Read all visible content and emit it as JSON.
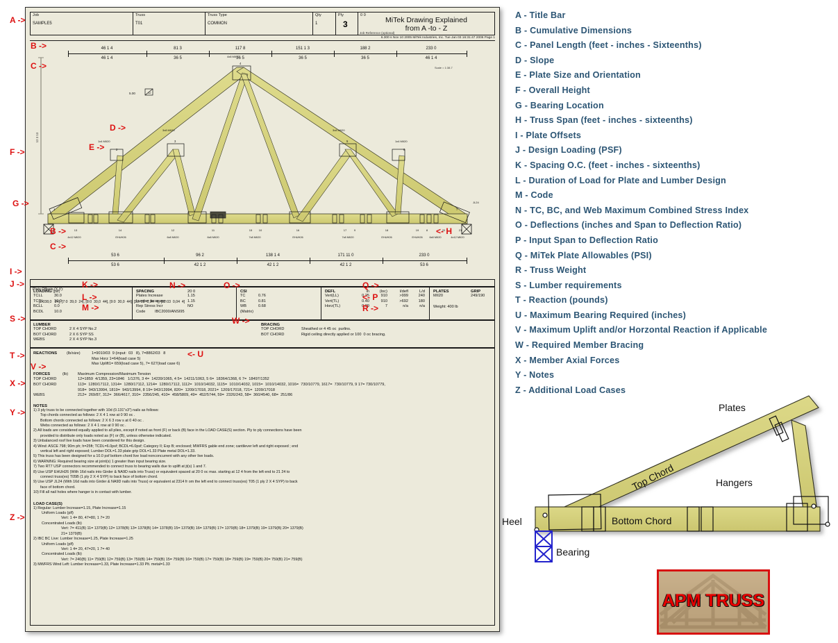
{
  "titlebar": {
    "job_label": "Job",
    "job_value": "SAMPLE5",
    "truss_label": "Truss",
    "truss_value": "T01",
    "trusstype_label": "Truss Type",
    "trusstype_value": "COMMON",
    "qty_label": "Qty",
    "qty_value": "1",
    "ply_label": "Ply",
    "ply_value": "3",
    "jobref_top": "0 0",
    "jobref_label": "Job Reference (optional)",
    "drawing_title_line1": "MiTek Drawing Explained",
    "drawing_title_line2": "from A -to - Z",
    "footer": "6.300 s Nov 10 2005 MiTek Industries, Inc.  Tue Jan 03 16:31:47 2006  Page 1"
  },
  "top_dims": {
    "cumulative": [
      "46 1 4",
      "81 3",
      "117 8",
      "151 1 3",
      "188 2",
      "233 0"
    ],
    "panel": [
      "46 1 4",
      "36 5",
      "36 5",
      "36 5",
      "36 5",
      "46 1 4"
    ],
    "scale_note": "Scale = 1:38.7"
  },
  "bottom_dims": {
    "cumulative": [
      "53 6",
      "96 2",
      "138 1 4",
      "171 11 0",
      "233 0"
    ],
    "panel": [
      "53 6",
      "42 1 2",
      "42 1 2",
      "42 1 2",
      "53 6"
    ]
  },
  "truss": {
    "slope": "5.00",
    "slope_run": "12",
    "height_label": "12 3 13",
    "plate_callouts": [
      {
        "id": "p1",
        "text": "1x4 MII20"
      },
      {
        "id": "p2",
        "text": "3x8 MII20"
      },
      {
        "id": "p3",
        "text": "4x8 MII20"
      },
      {
        "id": "p4",
        "text": "3x8 MII20"
      },
      {
        "id": "p5",
        "text": "1x4 MII20"
      }
    ],
    "joint_numbers": [
      "1",
      "2",
      "3",
      "4",
      "5",
      "6",
      "7"
    ],
    "bottom_joint_numbers": [
      "13",
      "14",
      "12",
      "11",
      "15",
      "10",
      "16",
      "17",
      "9",
      "18",
      "19",
      "8",
      "20",
      "21"
    ],
    "bottom_plates": [
      "4x12 MII20",
      "EHUH26",
      "6x8 MII20",
      "6x8 MII20",
      "7x8 MII20",
      "EHUH26",
      "7x8 MII20",
      "EHUH26",
      "EHUH26",
      "6x8 MII20",
      "EHUH26",
      "EHUH26",
      "4x12 MII20"
    ],
    "hanger_label": "EHUH26",
    "jl24_label": "JL24"
  },
  "plate_offsets": {
    "label": "Plate Offsets (X,Y):",
    "value": "[1:038,0   24], [7:0  39,0  24], [8:0  30,0  44], [9:0  30,0  44], [10: 03  0,04  4], [12:03  0,04  4]"
  },
  "loading": {
    "header": "LOADING",
    "unit": "(psf)",
    "rows": [
      {
        "name": "TCLL",
        "value": "30.0"
      },
      {
        "name": "TCDL",
        "value": "10.0"
      },
      {
        "name": "BCLL",
        "value": "0.0"
      },
      {
        "name": "BCDL",
        "value": "10.0"
      }
    ]
  },
  "spacing": {
    "header": "SPACING",
    "value": "20  0",
    "rows": [
      {
        "name": "Plates Increase",
        "value": "1.15"
      },
      {
        "name": "Lumber Increase",
        "value": "1.15"
      },
      {
        "name": "Rep Stress Incr",
        "value": "NO"
      },
      {
        "name": "Code",
        "value": "IBC2000/ANSI95"
      }
    ]
  },
  "csi": {
    "header": "CSI",
    "rows": [
      {
        "name": "TC",
        "value": "0.76"
      },
      {
        "name": "BC",
        "value": "0.81"
      },
      {
        "name": "WB",
        "value": "0.68"
      },
      {
        "name": "(Matrix)",
        "value": ""
      }
    ]
  },
  "defl": {
    "header": "DEFL",
    "cols": [
      "in",
      "(loc)",
      "l/defl",
      "L/d"
    ],
    "rows": [
      {
        "name": "Vert(LL)",
        "in": "0.25",
        "loc": "910",
        "ldefl": ">999",
        "ld": "240"
      },
      {
        "name": "Vert(TL)",
        "in": "0.40",
        "loc": "910",
        "ldefl": ">692",
        "ld": "180"
      },
      {
        "name": "Horz(TL)",
        "in": "0.09",
        "loc": "7",
        "ldefl": "n/a",
        "ld": "n/a"
      }
    ]
  },
  "plates": {
    "header_plates": "PLATES",
    "header_grip": "GRIP",
    "plate_value": "MII20",
    "grip_value": "249/190",
    "weight": "Weight: 400 lb"
  },
  "lumber": {
    "header": "LUMBER",
    "rows": [
      {
        "name": "TOP CHORD",
        "value": "2 X 4 SYP No.2"
      },
      {
        "name": "BOT CHORD",
        "value": "2 X 6 SYP SS"
      },
      {
        "name": "WEBS",
        "value": "2 X 4 SYP No.3"
      }
    ]
  },
  "bracing": {
    "header": "BRACING",
    "rows": [
      {
        "name": "TOP CHORD",
        "value": "Sheathed or 4 45 oc  purlins."
      },
      {
        "name": "BOT CHORD",
        "value": "Rigid ceiling directly applied or 100  0 oc bracing."
      }
    ]
  },
  "reactions": {
    "header": "REACTIONS",
    "unit": "(lb/size)",
    "line1": "1=9010/03  9 (input:  03   8), 7=8862/03   8",
    "line2": "Max Horz 1=64(load case 5)",
    "line3": "Max Uplift1= 659(load case 5), 7= 627(load case 6)"
  },
  "forces": {
    "header": "FORCES",
    "unit": "(lb)",
    "subtitle": "Maximum Compression/Maximum Tension",
    "top_chord_label": "TOP CHORD",
    "top_chord": "12=1859  4/1359, 23=1846   1/1376, 3 4=  14239/1065, 4 5=  14211/1063, 5 6=  18364/1368, 6 7=  18497/1352",
    "bot_chord_label": "BOT CHORD",
    "bot_chord_l1": "113=  1280/17112, 1314=  1280/17112, 1214=  1280/17112, 1112=  1010/14032, 1115=  1010/14032, 1015=  1010/14032, 1016=  730/10779, 1617=  730/10779, 9 17= 730/10779,",
    "bot_chord_l2": "918=  943/13994, 1819=  943/13994, 8 19= 943/13994, 820=  1209/17018, 2021=  1209/17018, 721=  1209/17018",
    "webs_label": "WEBS",
    "webs": "212=  269/87, 312=  366/4617, 310=  2356/245, 410=  458/5809, 49=  452/5744, 59=  2326/243, 58=  360/4540, 68=  251/86"
  },
  "notes": {
    "header": "NOTES",
    "items": [
      "1) 3 ply truss to be connected together with 10d (0.131\"x3\") nails as follows:",
      "Top chords connected as follows: 2 X 4  1 row  at 0 90 oc .",
      "Bottom chords connected as follows: 2 X 6  3 row s at 0 40 oc .",
      "Webs connected as follows: 2 X 4  1 row  at 0 90 oc .",
      "2) All loads are considered equally applied to all plies, except if noted as front (F) or back (B) face in the LOAD CASE(S) section. Ply to ply connections have been",
      "provided to distribute only loads noted as (F) or (B), unless otherwise indicated.",
      "3) Unbalanced roof live loads have been considered for this design.",
      "4) Wind: ASCE 798; 90m ph; h=25ft; TCDL=6.0psf; BCDL=6.0psf; Category II; Exp B; enclosed; MWFRS gable end zone; cantilever left and right exposed ; end",
      "vertical left and right exposed;  Lumber DOL=1.33 plate grip DOL=1.33  Plate metal DOL=1.33.",
      "5) This truss has been designed for a 10.0 psf bottom chord live load nonconcurrent with any other live loads.",
      "6) WARNING: Required bearing size at joint(s) 1 greater than input bearing size.",
      "7) Two RT7 USP connectors recommended to connect truss to bearing walls due to uplift at jt(s) 1 and 7.",
      "8) Use USP EHUH26 (With 16d nails into Girder & NA9D nails into Truss) or equivalent spaced at 20  0 oc max. starting at 12   4 from the left end to 21 24 to",
      "connect truss(es) T05B (1 ply 2 X 4 SYP)  to back face of bottom chord.",
      "9) Use USP JL24 (With 16d nails into Girder & NA9D nails into Truss) or equivalent at 2314 fr  om the left end to connect truss(es) T05 (1 ply 2 X 4 SYP)  to back",
      "face of bottom chord.",
      "10) Fill all nail holes where hanger is in contact with lumber."
    ]
  },
  "load_cases": {
    "header": "LOAD CASE(S)",
    "items": [
      "1) Regular: Lumber Increase=1.15, Plate Increase=1.15",
      "Uniform Loads (plf)",
      "Vert: 1 4= 80, 47=80, 1   7= 20",
      "Concentrated Loads (lb)",
      "Vert: 7= 411(B) 11= 1379(B) 12= 1378(B) 13= 1378(B) 14= 1378(B) 15= 1379(B) 16= 1379(B) 17= 1379(B) 18= 1379(B) 19= 1379(B) 20= 1379(B)",
      "21= 1379(B)",
      "2) IBC BC Live: Lumber Increase=1.25, Plate Increase=1.25",
      "Uniform Loads (plf)",
      "Vert: 1 4= 20, 47=20, 1   7= 40",
      "Concentrated Loads (lb)",
      "Vert: 7= 240(B) 11= 759(B) 12= 759(B) 13= 759(B) 14= 759(B) 15= 759(B) 16= 759(B) 17= 759(B) 18= 759(B) 19= 759(B) 20= 759(B) 21= 759(B)",
      "3) MWFRS Wind Left: Lumber Increase=1.33, Plate Increase=1.33 Plt. metal=1.33"
    ]
  },
  "callouts": [
    {
      "id": "A",
      "text": "A ->"
    },
    {
      "id": "B1",
      "text": "B ->"
    },
    {
      "id": "C1",
      "text": "C ->"
    },
    {
      "id": "D",
      "text": "D ->"
    },
    {
      "id": "E",
      "text": "E ->"
    },
    {
      "id": "F",
      "text": "F ->"
    },
    {
      "id": "G",
      "text": "G ->"
    },
    {
      "id": "B2",
      "text": "B ->"
    },
    {
      "id": "C2",
      "text": "C ->"
    },
    {
      "id": "H",
      "text": "<- H"
    },
    {
      "id": "I",
      "text": "I ->"
    },
    {
      "id": "J",
      "text": "J ->"
    },
    {
      "id": "K",
      "text": "K ->"
    },
    {
      "id": "L",
      "text": "L ->"
    },
    {
      "id": "M",
      "text": "M ->"
    },
    {
      "id": "N",
      "text": "N ->"
    },
    {
      "id": "O",
      "text": "O ->"
    },
    {
      "id": "P",
      "text": "<- P"
    },
    {
      "id": "Q",
      "text": "Q ->"
    },
    {
      "id": "R",
      "text": "R ->"
    },
    {
      "id": "S",
      "text": "S ->"
    },
    {
      "id": "T",
      "text": "T ->"
    },
    {
      "id": "U",
      "text": "<- U"
    },
    {
      "id": "V",
      "text": "V ->"
    },
    {
      "id": "W",
      "text": "W ->"
    },
    {
      "id": "X",
      "text": "X ->"
    },
    {
      "id": "Y",
      "text": "Y ->"
    },
    {
      "id": "Z",
      "text": "Z ->"
    }
  ],
  "legend": {
    "items": [
      "A - Title Bar",
      "B - Cumulative Dimensions",
      "C - Panel Length (feet - inches - Sixteenths)",
      "D - Slope",
      "E - Plate Size and Orientation",
      "F - Overall Height",
      "G - Bearing Location",
      "H - Truss Span (feet - inches - sixteenths)",
      "I - Plate Offsets",
      "J - Design Loading (PSF)",
      "K - Spacing O.C. (feet - inches - sixteenths)",
      "L - Duration of Load for Plate and Lumber Design",
      "M - Code",
      "N - TC, BC, and Web Maximum Combined Stress Index",
      "O - Deflections (inches and Span to Deflection Ratio)",
      "P - Input Span to Deflection Ratio",
      "Q - MiTek Plate Allowables (PSI)",
      "R - Truss Weight",
      "S - Lumber requirements",
      "T - Reaction (pounds)",
      "U - Maximum Bearing Required (inches)",
      "V - Maximum Uplift and/or Horzontal Reaction if Applicable",
      "W - Required Member Bracing",
      "X - Member Axial Forces",
      "Y - Notes",
      "Z - Additional Load Cases"
    ]
  },
  "diagram": {
    "labels": {
      "plates": "Plates",
      "top_chord": "Top Chord",
      "hangers": "Hangers",
      "bottom_chord": "Bottom Chord",
      "heel": "Heel",
      "bearing": "Bearing"
    },
    "colors": {
      "lumber": "#d8d382",
      "bearing": "#2222cc",
      "outline": "#000000"
    }
  },
  "logo": {
    "text": "APM TRUSS",
    "border_color": "#d81010"
  }
}
